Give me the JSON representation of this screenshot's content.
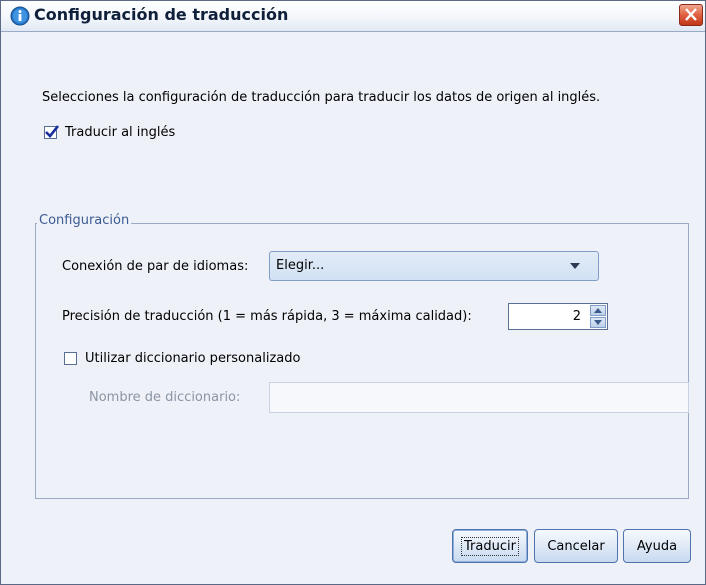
{
  "window": {
    "title": "Configuración de traducción",
    "icon": "info-icon",
    "close_icon": "close-icon"
  },
  "description": "Selecciones la configuración de traducción para traducir los datos de origen al inglés.",
  "translate_checkbox": {
    "label": "Traducir al inglés",
    "checked": true
  },
  "config_group": {
    "title": "Configuración",
    "language_pair": {
      "label": "Conexión de par de idiomas:",
      "value": "Elegir..."
    },
    "accuracy": {
      "label": "Precisión de traducción (1 = más rápida, 3 = máxima calidad):",
      "value": "2"
    },
    "custom_dictionary": {
      "label": "Utilizar diccionario personalizado",
      "checked": false
    },
    "dictionary_name": {
      "label": "Nombre de diccionario:",
      "value": ""
    }
  },
  "buttons": {
    "translate": "Traducir",
    "cancel": "Cancelar",
    "help": "Ayuda"
  },
  "colors": {
    "dialog_bg": "#eef2f8",
    "accent": "#4f74ad",
    "close": "#e06040"
  }
}
